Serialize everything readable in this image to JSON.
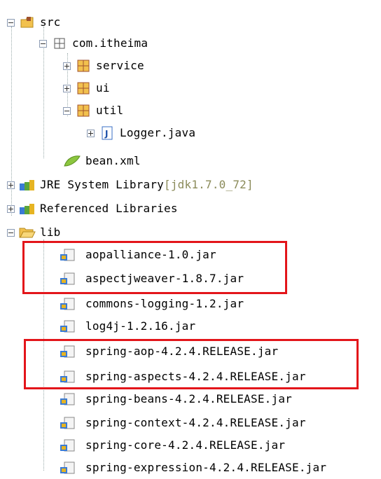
{
  "tree": {
    "src": {
      "label": "src"
    },
    "package": {
      "label": "com.itheima"
    },
    "service": {
      "label": "service"
    },
    "ui": {
      "label": "ui"
    },
    "util": {
      "label": "util"
    },
    "logger": {
      "label": "Logger.java"
    },
    "bean": {
      "label": "bean.xml"
    },
    "jre": {
      "label": "JRE System Library ",
      "decoration": "[jdk1.7.0_72]"
    },
    "reflibs": {
      "label": "Referenced Libraries"
    },
    "lib": {
      "label": "lib"
    },
    "jars": [
      "aopalliance-1.0.jar",
      "aspectjweaver-1.8.7.jar",
      "commons-logging-1.2.jar",
      "log4j-1.2.16.jar",
      "spring-aop-4.2.4.RELEASE.jar",
      "spring-aspects-4.2.4.RELEASE.jar",
      "spring-beans-4.2.4.RELEASE.jar",
      "spring-context-4.2.4.RELEASE.jar",
      "spring-core-4.2.4.RELEASE.jar",
      "spring-expression-4.2.4.RELEASE.jar"
    ]
  },
  "colors": {
    "highlight": "#e3151a",
    "folder": "#f2c14e",
    "package": "#a0522d"
  },
  "icons": {
    "src": "source-folder-icon",
    "package": "package-icon",
    "java": "java-file-icon",
    "xml": "xml-file-icon",
    "library": "library-icon",
    "folder": "folder-open-icon",
    "jar": "jar-file-icon"
  }
}
